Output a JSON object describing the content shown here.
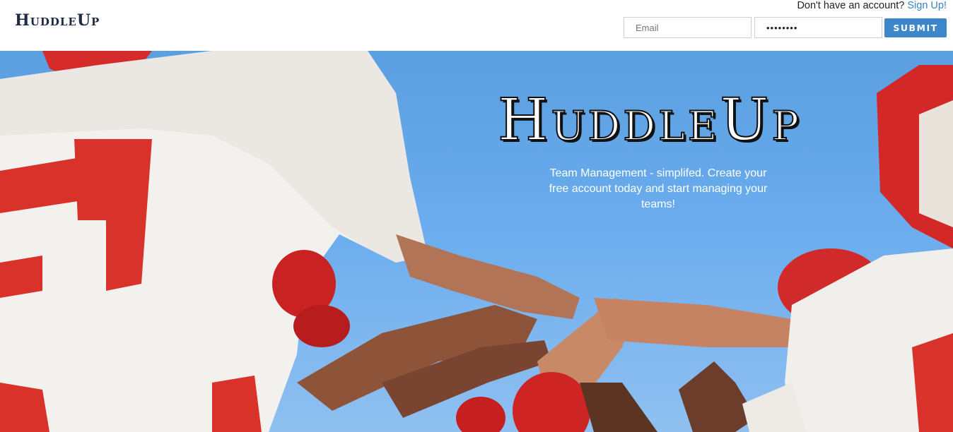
{
  "header": {
    "logo": "HuddleUp",
    "signup_prompt": "Don't have an account?",
    "signup_link": "Sign Up!",
    "email_placeholder": "Email",
    "password_value": "••••••••",
    "submit_label": "SUBMIT"
  },
  "hero": {
    "title": "HuddleUp",
    "tagline": "Team Management - simplifed. Create your free account today and start managing your teams!"
  },
  "colors": {
    "accent": "#3c86c9",
    "link": "#3b82c4",
    "sky": "#6aacee",
    "jersey_red": "#d9322b"
  }
}
